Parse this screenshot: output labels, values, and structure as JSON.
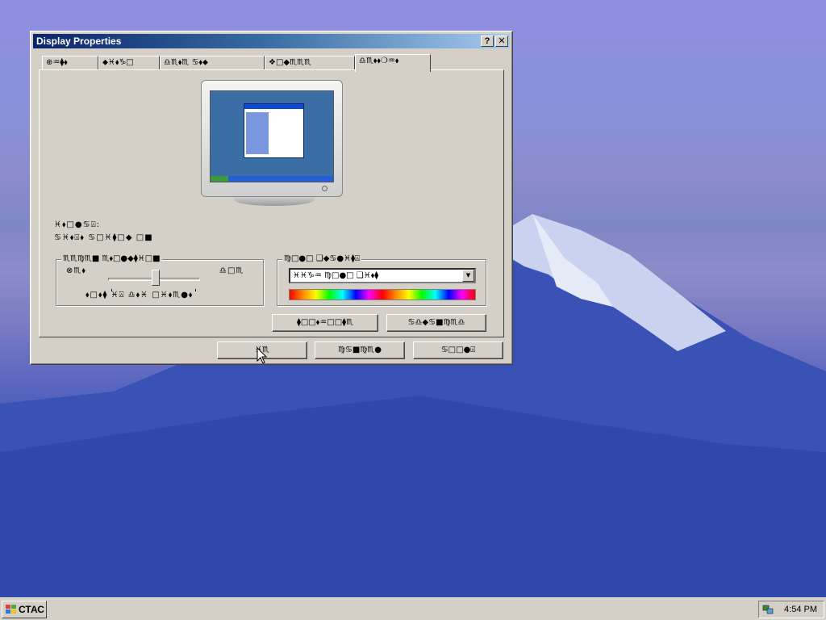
{
  "window": {
    "title": "Display Properties",
    "help_label": "?",
    "close_label": "✕"
  },
  "tabs": [
    "⊕♒︎⧫︎⬧︎",
    "⬥︎♓︎⬧︎♑︎□︎",
    "♎︎♏︎⬧︎♏︎ ♋︎⬧︎⬥︎",
    "⧫︎□︎♏︎♏︎◆︎♏︎",
    "❖︎□︎◆︎♏︎♏︎♏︎",
    "♎︎♏︎⬧︎⬧︎❍︎♒︎⬧︎"
  ],
  "active_tab_index": 5,
  "panel": {
    "display_label": "♓︎⬧︎□︎●︎♋︎⍓︎:",
    "display_value": "♋︎♓︎⬧︎⍓︎⬧︎ ♋︎□︎♓︎⧫︎□︎◆︎ □︎■︎",
    "resolution_group": {
      "title": "♏︎♏︎♍︎♏︎■︎ ♏︎⬧︎□︎●︎◆︎⧫︎♓︎□︎■︎",
      "less_label": "⊗♏︎⬧︎",
      "more_label": "♎︎□︎♏︎",
      "value": "⬧︎□︎⬧︎⧫︎ ♓︎⍓︎ ♎︎⬧︎♓︎ □︎♓︎⬧︎♏︎●︎⬧︎"
    },
    "color_group": {
      "title": "♍︎□︎●︎□︎ ❑︎◆︎♋︎●︎♓︎⧫︎⍓︎",
      "select_value": "♓︎♓︎♑︎♒︎ ♍︎□︎●︎□︎ ❑︎♓︎⬧︎⧫︎"
    },
    "troubleshoot_label": "⧫︎□︎□︎⬧︎♒︎□︎□︎⧫︎♏︎",
    "advanced_label": "♋︎♎︎◆︎♋︎■︎♍︎♏︎♎︎"
  },
  "buttons": {
    "ok": "♓︎♏︎",
    "cancel": "♍︎♋︎■︎♍︎♏︎●︎",
    "apply": "♋︎□︎□︎●︎⍓︎"
  },
  "taskbar": {
    "start_label": "СТАС",
    "clock": "4:54 PM"
  },
  "colors": {
    "title_gradient_start": "#0a246a",
    "title_gradient_end": "#a6caf0",
    "face": "#d4d0c8",
    "desktop_top": "#8f8fe0",
    "desktop_bottom": "#2a41a4"
  }
}
